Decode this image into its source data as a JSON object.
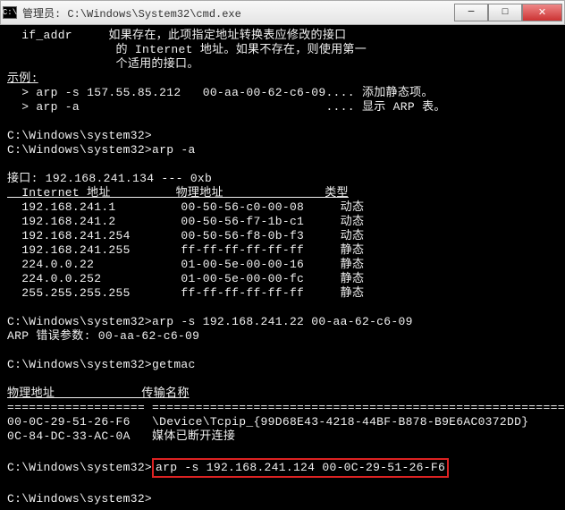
{
  "titlebar": {
    "icon_label": "C:\\",
    "text": "管理员: C:\\Windows\\System32\\cmd.exe"
  },
  "window_buttons": {
    "minimize": "─",
    "maximize": "□",
    "close": "✕"
  },
  "content": {
    "l1": "  if_addr     如果存在，此项指定地址转换表应修改的接口",
    "l2": "               的 Internet 地址。如果不存在，则使用第一",
    "l3": "               个适用的接口。",
    "l4": "示例:",
    "l5": "  > arp -s 157.55.85.212   00-aa-00-62-c6-09.... 添加静态项。",
    "l6": "  > arp -a                                  .... 显示 ARP 表。",
    "l7": "",
    "l8": "C:\\Windows\\system32>",
    "l9": "C:\\Windows\\system32>arp -a",
    "l10": "",
    "l11": "接口: 192.168.241.134 --- 0xb",
    "l12": "  Internet 地址         物理地址              类型",
    "l13": "  192.168.241.1         00-50-56-c0-00-08     动态",
    "l14": "  192.168.241.2         00-50-56-f7-1b-c1     动态",
    "l15": "  192.168.241.254       00-50-56-f8-0b-f3     动态",
    "l16": "  192.168.241.255       ff-ff-ff-ff-ff-ff     静态",
    "l17": "  224.0.0.22            01-00-5e-00-00-16     静态",
    "l18": "  224.0.0.252           01-00-5e-00-00-fc     静态",
    "l19": "  255.255.255.255       ff-ff-ff-ff-ff-ff     静态",
    "l20": "",
    "l21": "C:\\Windows\\system32>arp -s 192.168.241.22 00-aa-62-c6-09",
    "l22": "ARP 错误参数: 00-aa-62-c6-09",
    "l23": "",
    "l24": "C:\\Windows\\system32>getmac",
    "l25": "",
    "l26": "物理地址            传输名称",
    "l27": "=================== ==========================================================",
    "l28": "00-0C-29-51-26-F6   \\Device\\Tcpip_{99D68E43-4218-44BF-B878-B9E6AC0372DD}",
    "l29": "0C-84-DC-33-AC-0A   媒体已断开连接",
    "l30": "",
    "l31_a": "C:\\Windows\\system32>",
    "l31_b": "arp -s 192.168.241.124 00-0C-29-51-26-F6",
    "l32": "",
    "l33": "C:\\Windows\\system32>"
  }
}
